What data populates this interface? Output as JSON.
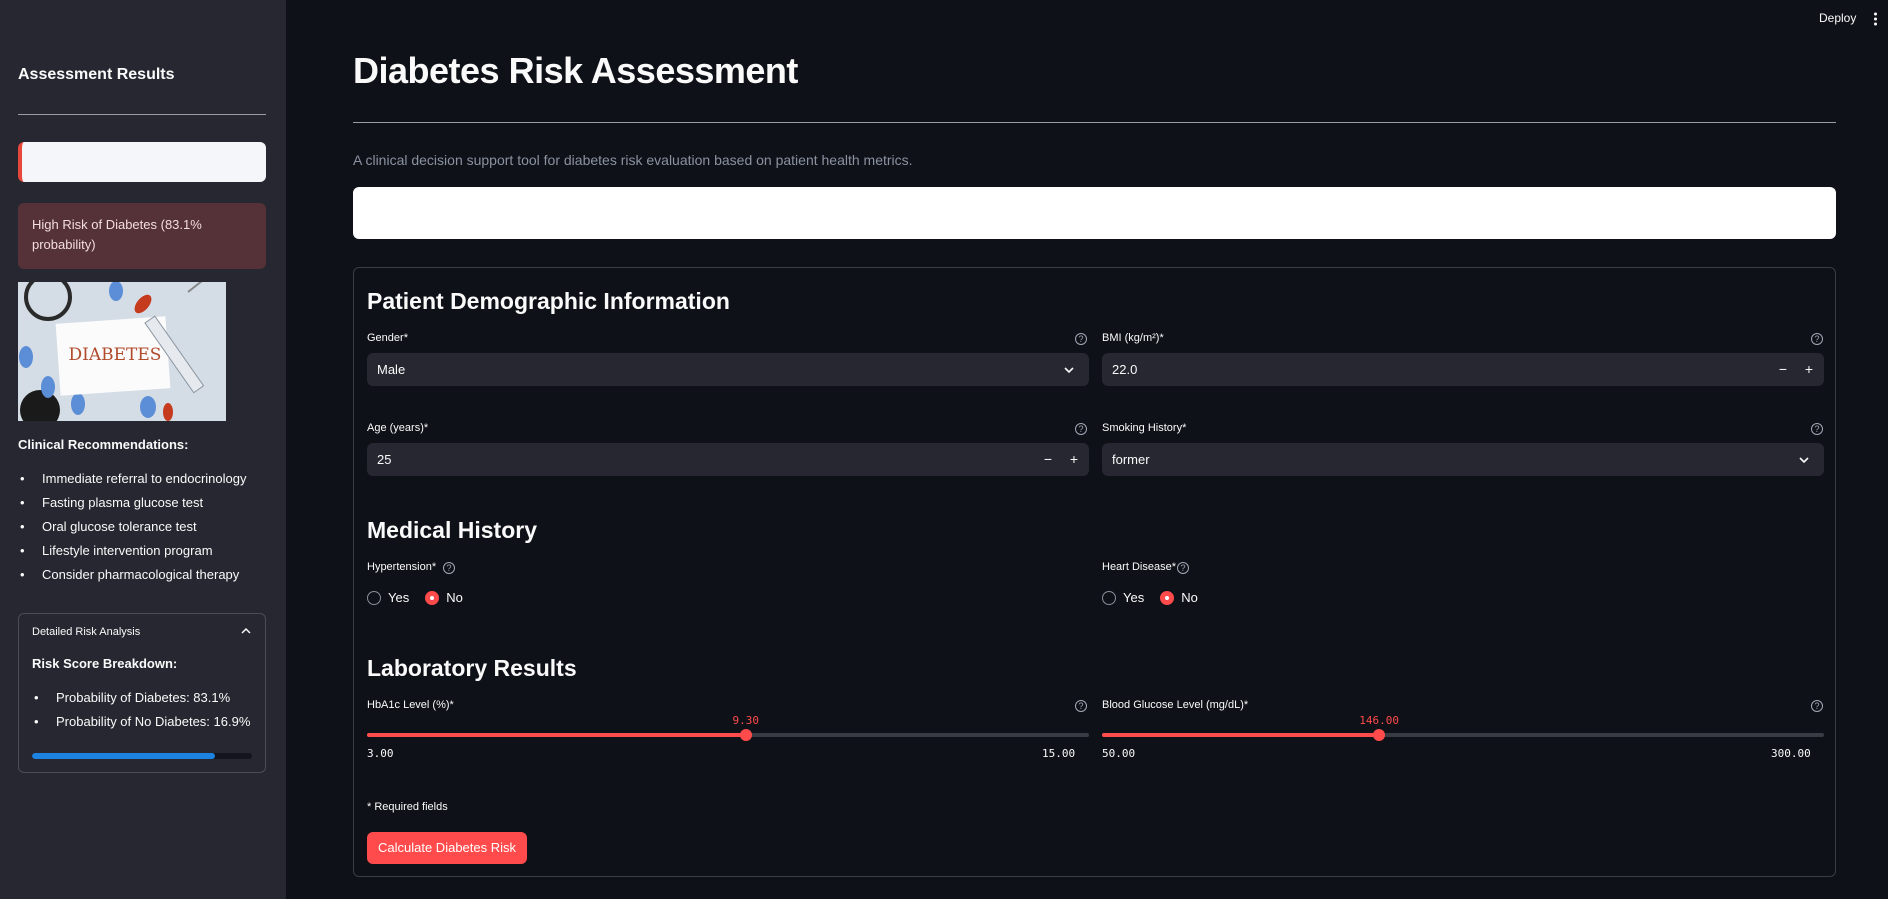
{
  "sidebar": {
    "title": "Assessment Results",
    "alert_text": "High Risk of Diabetes (83.1% probability)",
    "image_text": "DIABETES",
    "recommendations_title": "Clinical Recommendations:",
    "recommendations": [
      "Immediate referral to endocrinology",
      "Fasting plasma glucose test",
      "Oral glucose tolerance test",
      "Lifestyle intervention program",
      "Consider pharmacological therapy"
    ],
    "expander": {
      "title": "Detailed Risk Analysis",
      "subtitle": "Risk Score Breakdown:",
      "items": [
        "Probability of Diabetes: 83.1%",
        "Probability of No Diabetes: 16.9%"
      ],
      "progress": 0.831
    }
  },
  "topbar": {
    "deploy_label": "Deploy"
  },
  "main": {
    "title": "Diabetes Risk Assessment",
    "description": "A clinical decision support tool for diabetes risk evaluation based on patient health metrics.",
    "sections": {
      "demographic": "Patient Demographic Information",
      "medical": "Medical History",
      "lab": "Laboratory Results"
    },
    "gender": {
      "label": "Gender*",
      "value": "Male"
    },
    "bmi": {
      "label": "BMI (kg/m²)*",
      "value": "22.0"
    },
    "age": {
      "label": "Age (years)*",
      "value": "25"
    },
    "smoking": {
      "label": "Smoking History*",
      "value": "former"
    },
    "hypertension": {
      "label": "Hypertension*",
      "options": [
        "Yes",
        "No"
      ],
      "selected": "No"
    },
    "heart_disease": {
      "label": "Heart Disease*",
      "options": [
        "Yes",
        "No"
      ],
      "selected": "No"
    },
    "hba1c": {
      "label": "HbA1c Level (%)*",
      "value": "9.30",
      "min": "3.00",
      "max": "15.00",
      "fraction": 0.525
    },
    "glucose": {
      "label": "Blood Glucose Level (mg/dL)*",
      "value": "146.00",
      "min": "50.00",
      "max": "300.00",
      "fraction": 0.384
    },
    "required_note": "* Required fields",
    "calculate_button": "Calculate Diabetes Risk",
    "help_glyph": "?",
    "minus_glyph": "−",
    "plus_glyph": "+"
  },
  "colors": {
    "accent": "#ff4b4b",
    "sidebar_bg": "#262730",
    "app_bg": "#0e1117",
    "progress": "#1c83e1",
    "alert_bg": "#553138"
  }
}
